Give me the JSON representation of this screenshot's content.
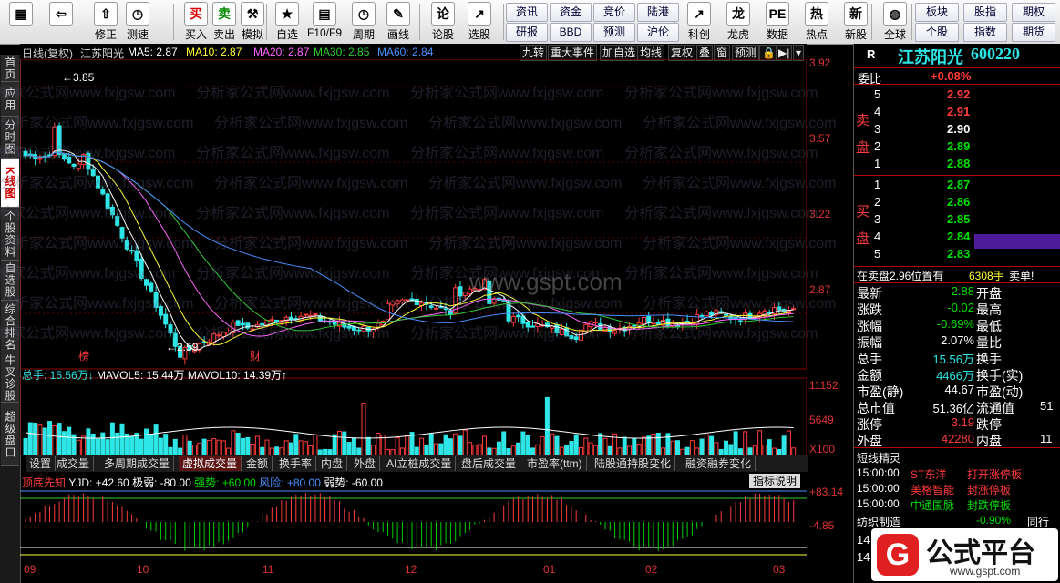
{
  "toolbar": {
    "buttons": [
      {
        "label": "",
        "icon": "windows-logo-icon"
      },
      {
        "label": "",
        "icon": "back-arrow-icon"
      },
      {
        "label": "修正",
        "icon": "up-arrow-icon"
      },
      {
        "label": "测速",
        "icon": "clock-icon"
      },
      {
        "label": "买入",
        "icon": "buy-icon"
      },
      {
        "label": "卖出",
        "icon": "sell-icon"
      },
      {
        "label": "模拟",
        "icon": "gavel-icon"
      },
      {
        "label": "自选",
        "icon": "star-icon"
      },
      {
        "label": "F10/F9",
        "icon": "info-icon"
      },
      {
        "label": "周期",
        "icon": "clock-icon"
      },
      {
        "label": "画线",
        "icon": "pencil-icon"
      },
      {
        "label": "论股",
        "icon": "discuss-icon"
      },
      {
        "label": "选股",
        "icon": "chart-icon"
      }
    ],
    "grid1": [
      [
        "资讯",
        "资金",
        "竞价",
        "陆港"
      ],
      [
        "研报",
        "BBD",
        "预测",
        "沪伦"
      ]
    ],
    "buttons2": [
      {
        "label": "科创",
        "icon": "chart-icon"
      },
      {
        "label": "龙虎",
        "icon": "dragon-icon"
      },
      {
        "label": "数据",
        "icon": "pe-icon"
      },
      {
        "label": "热点",
        "icon": "hot-icon"
      },
      {
        "label": "新股",
        "icon": "newstock-icon"
      },
      {
        "label": "全球",
        "icon": "globe-icon"
      }
    ],
    "grid2": [
      [
        "板块",
        "股指",
        "期权"
      ],
      [
        "个股",
        "指数",
        "期货"
      ]
    ]
  },
  "left_tabs": [
    "首页",
    "应用",
    "分时图",
    "K线图",
    "个股资料",
    "自选股",
    "综合排名",
    "牛叉诊股",
    "超级盘口"
  ],
  "chart_header": {
    "type": "日线(复权)",
    "stock": "江苏阳光",
    "ma5": "MA5: 2.87",
    "ma10": "MA10: 2.87",
    "ma20": "MA20: 2.87",
    "ma30": "MA30: 2.85",
    "ma60": "MA60: 2.84",
    "tools": [
      "九转",
      "重大事件",
      "加自选",
      "均线",
      "复权",
      "叠",
      "窗",
      "预测"
    ]
  },
  "price_axis": [
    "3.92",
    "3.57",
    "3.22",
    "2.87"
  ],
  "volume_axis": [
    "11152",
    "5649",
    "X100"
  ],
  "indicator_axis": [
    "+83.14",
    "-4.85"
  ],
  "annotations": {
    "high": "3.85",
    "low": "2.59",
    "mark1": "榜",
    "mark2": "财"
  },
  "volume_header": {
    "total": "总手: 15.56万↓",
    "mavol5": "MAVOL5: 15.44万",
    "mavol10": "MAVOL10: 14.39万↑"
  },
  "indicator_tabs": [
    "设置",
    "成交量",
    "多周期成交量",
    "虚拟成交量",
    "金额",
    "换手率",
    "内盘",
    "外盘",
    "AI立桩成交量",
    "盘后成交量",
    "市盈率(ttm)",
    "陆股通持股变化",
    "融资融券变化"
  ],
  "indicator_header": {
    "name": "顶底先知",
    "yjd": "YJD: +42.60",
    "jr": "极弱: -80.00",
    "qs": "强势: +60.00",
    "fx": "风险: +80.00",
    "rs": "弱势: -60.00",
    "help": "指标说明"
  },
  "x_axis": [
    "09",
    "10",
    "11",
    "12",
    "01",
    "02",
    "03"
  ],
  "watermark": "分析家公式网www.fxjgsw.com",
  "watermark2": "www.gspt.com",
  "right_panel": {
    "r": "R",
    "name": "江苏阳光",
    "code": "600220",
    "weibi_label": "委比",
    "weibi": "+0.08%",
    "sell_label": "卖盘",
    "buy_label": "买盘",
    "asks": [
      {
        "n": "5",
        "p": "2.92"
      },
      {
        "n": "4",
        "p": "2.91"
      },
      {
        "n": "3",
        "p": "2.90"
      },
      {
        "n": "2",
        "p": "2.89"
      },
      {
        "n": "1",
        "p": "2.88"
      }
    ],
    "bids": [
      {
        "n": "1",
        "p": "2.87"
      },
      {
        "n": "2",
        "p": "2.86"
      },
      {
        "n": "3",
        "p": "2.85"
      },
      {
        "n": "4",
        "p": "2.84"
      },
      {
        "n": "5",
        "p": "2.83"
      }
    ],
    "status_line": "在卖盘2.96位置有",
    "status_vol": "6308手",
    "status_word": "卖单!",
    "quotes": [
      [
        "最新",
        "2.88",
        "开盘",
        ""
      ],
      [
        "涨跌",
        "-0.02",
        "最高",
        ""
      ],
      [
        "涨幅",
        "-0.69%",
        "最低",
        ""
      ],
      [
        "振幅",
        "2.07%",
        "量比",
        ""
      ],
      [
        "总手",
        "15.56万",
        "换手",
        ""
      ],
      [
        "金额",
        "4466万",
        "换手(实)",
        ""
      ],
      [
        "市盈(静)",
        "44.67",
        "市盈(动)",
        ""
      ],
      [
        "总市值",
        "51.36亿",
        "流通值",
        "51"
      ],
      [
        "涨停",
        "3.19",
        "跌停",
        ""
      ],
      [
        "外盘",
        "42280",
        "内盘",
        "11"
      ]
    ],
    "short_title": "短线精灵",
    "short_items": [
      {
        "time": "15:00:00",
        "name": "ST东洋",
        "event": "打开涨停板"
      },
      {
        "time": "15:00:00",
        "name": "美格智能",
        "event": "封涨停板"
      },
      {
        "time": "15:00:00",
        "name": "中通国脉",
        "event": "封跌停板"
      }
    ],
    "sector": "纺织制造",
    "sector_change": "-0.90%",
    "sector_more": "同行",
    "bottom_nums": [
      "14",
      "14"
    ],
    "logo_text": "公式平台",
    "logo_url": "www.gspt.com"
  },
  "colors": {
    "up": "#ff3b3b",
    "down": "#2ee6e6",
    "ma5": "#ffffff",
    "ma10": "#ffff33",
    "ma20": "#ff66ff",
    "ma30": "#33cc33",
    "ma60": "#4a8fff"
  }
}
